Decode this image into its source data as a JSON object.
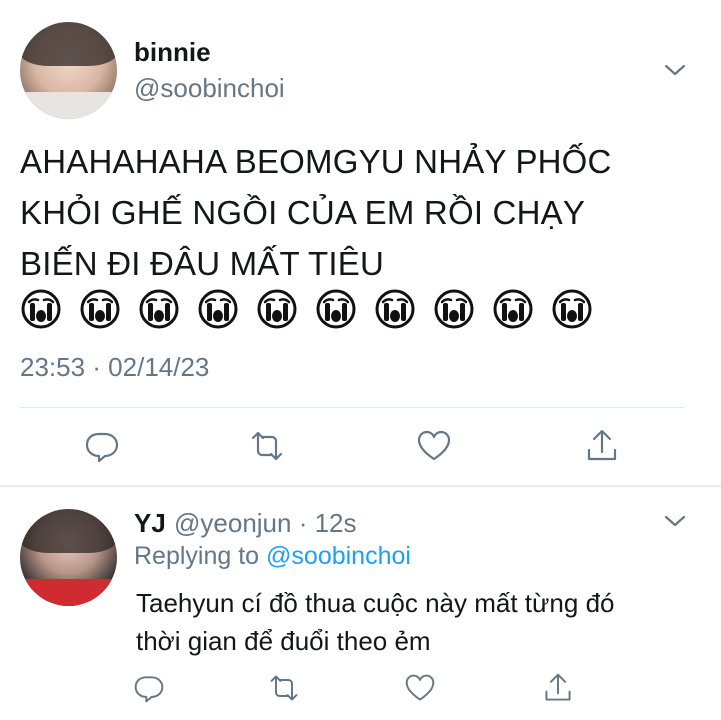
{
  "tweet": {
    "display_name": "binnie",
    "handle": "@soobinchoi",
    "text_lines": [
      "AHAHAHAHA BEOMGYU NHẢY PHỐC",
      "KHỎI GHẾ NGỒI CỦA EM RỒI CHẠY",
      "BIẾN ĐI ĐÂU MẤT TIÊU"
    ],
    "emoji": [
      "😭",
      "😭",
      "😭",
      "😭",
      "😭",
      "😭",
      "😭",
      "😭",
      "😭",
      "😭"
    ],
    "timestamp": "23:53 · 02/14/23",
    "actions": [
      "reply-icon",
      "retweet-icon",
      "like-icon",
      "share-icon"
    ]
  },
  "reply": {
    "display_name": "YJ",
    "handle_time": "@yeonjun · 12s",
    "replying_prefix": "Replying to",
    "replying_to": "@soobinchoi",
    "text_lines": [
      "Taehyun cí đồ thua cuộc này mất từng đó",
      "thời gian để đuổi theo ẻm"
    ],
    "actions": [
      "reply-icon",
      "retweet-icon",
      "like-icon",
      "share-icon"
    ]
  },
  "colors": {
    "text": "#14171a",
    "secondary": "#657786",
    "link": "#1da1f2",
    "divider": "#e1e8ed"
  }
}
